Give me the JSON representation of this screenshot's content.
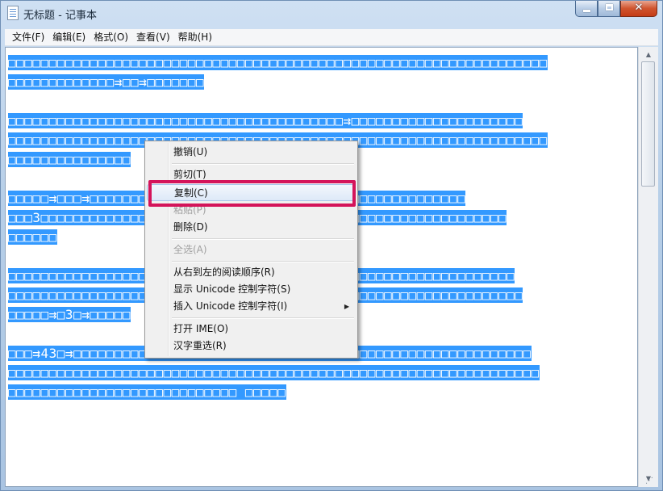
{
  "window": {
    "title": "无标题 - 记事本",
    "minimize_glyph": "",
    "maximize_glyph": "",
    "close_glyph": "✕"
  },
  "menubar": {
    "items": [
      "文件(F)",
      "编辑(E)",
      "格式(O)",
      "查看(V)",
      "帮助(H)"
    ]
  },
  "editor": {
    "selected": true,
    "paragraphs": [
      {
        "lines": [
          "□□□□□□□□□□□□□□□□□□□□□□□□□□□□□□□□□□□□□□□□□□□□□□□□□□□□□□□□□□□□□□□□□□",
          "□□□□□□□□□□□□□⇉□□⇉□□□□□□□"
        ]
      },
      {
        "lines": [
          "□□□□□□□□□□□□□□□□□□□□□□□□□□□□□□□□□□□□□□□□□⇉□□□□□□□□□□□□□□□□□□□□□",
          "□□□□□□□□□□□□□□□□□□□□□□□□□□□□□□□□□□□□□□□□□□□□□□□□□□□□□□□□□□□□□□□□□□",
          "□□□□□□□□□□□□□□□"
        ]
      },
      {
        "lines": [
          "□□□□□⇉□□□⇉□□□□□□□□□□□□□□□□□□□□□□□□□□□□□□□□□□□□□□□□□□□□□□",
          "□□□3□□□□□□□□□□□□□□□□□□□□□□□□□□□□□□□□□□□□□□□□□□□□□□□□□□□□□□□□□",
          "□□□□□□"
        ]
      },
      {
        "lines": [
          "□□□□□□□□□□□□□□□□□□□□□□□□□□□□□□⇉□□□□□□□□□□□□□□□□□□□□□□□□□□□□□□□",
          "□□□□□□□□□□□□□□□□□□□□□□□□□□□□□□□□□□□□□□□□□□□□□□□□□□□□□□□□□□□□□□□",
          "□□□□□⇉□3□⇉□□□□□"
        ]
      },
      {
        "lines": [
          "□□□⇉43□⇉□□□□□□□□□□□□□□□□□□□□□□□□□□□□□□□□□□□□□□□□□□□□□□□□□□□□□□□□",
          "□□□□□□□□□□□□□□□□□□□□□□□□□□□□□□□□□□□□□□□□□□□□□□□□□□□□□□□□□□□□□□□□□",
          "□□□□□□□□□□□□□□□□□□□□□□□□□□□□ □□□□□"
        ]
      }
    ]
  },
  "context_menu": {
    "items": [
      {
        "label": "撤销(U)",
        "enabled": true
      },
      {
        "label": "剪切(T)",
        "enabled": true
      },
      {
        "label": "复制(C)",
        "enabled": true,
        "hovered": true
      },
      {
        "label": "粘贴(P)",
        "enabled": false
      },
      {
        "label": "删除(D)",
        "enabled": true
      },
      {
        "label": "全选(A)",
        "enabled": false
      },
      {
        "label": "从右到左的阅读顺序(R)",
        "enabled": true
      },
      {
        "label": "显示 Unicode 控制字符(S)",
        "enabled": true
      },
      {
        "label": "插入 Unicode 控制字符(I)",
        "enabled": true,
        "submenu": true
      },
      {
        "label": "打开 IME(O)",
        "enabled": true
      },
      {
        "label": "汉字重选(R)",
        "enabled": true
      }
    ],
    "submenu_arrow": "▶"
  },
  "scrollbar": {
    "up_arrow": "▲",
    "down_arrow": "▼"
  },
  "colors": {
    "selection": "#3399ff",
    "highlight_box": "#d4145a",
    "menu_hover": "#dde9f8"
  }
}
